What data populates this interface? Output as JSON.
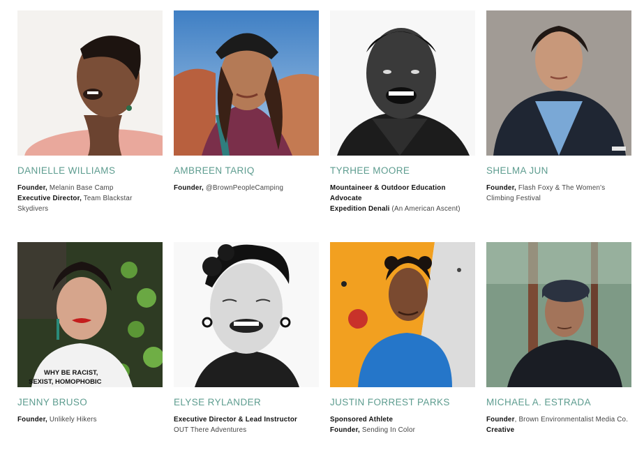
{
  "people": [
    {
      "name": "DANIELLE WILLIAMS",
      "photo_alt": "portrait-danielle",
      "roles": [
        {
          "title": "Founder,",
          "org": " Melanin Base Camp"
        },
        {
          "title": "Executive Director,",
          "org": " Team Blackstar Skydivers"
        }
      ]
    },
    {
      "name": "AMBREEN TARIQ",
      "photo_alt": "portrait-ambreen",
      "roles": [
        {
          "title": "Founder,",
          "org": " @BrownPeopleCamping"
        }
      ]
    },
    {
      "name": "TYRHEE MOORE",
      "photo_alt": "portrait-tyrhee",
      "roles": [
        {
          "title": "Mountaineer & Outdoor Education Advocate",
          "org": ""
        },
        {
          "title": "Expedition Denali",
          "org": " (An American Ascent)"
        }
      ]
    },
    {
      "name": "SHELMA JUN",
      "photo_alt": "portrait-shelma",
      "roles": [
        {
          "title": "Founder,",
          "org": " Flash Foxy & The Women's Climbing Festival"
        }
      ]
    },
    {
      "name": "JENNY BRUSO",
      "photo_alt": "portrait-jenny",
      "roles": [
        {
          "title": "Founder,",
          "org": " Unlikely Hikers"
        }
      ]
    },
    {
      "name": "ELYSE RYLANDER",
      "photo_alt": "portrait-elyse",
      "roles": [
        {
          "title": "Executive Director & Lead Instructor",
          "org": ""
        },
        {
          "title": "",
          "org": "OUT There Adventures"
        }
      ]
    },
    {
      "name": "JUSTIN FORREST PARKS",
      "photo_alt": "portrait-justin",
      "roles": [
        {
          "title": "Sponsored Athlete",
          "org": ""
        },
        {
          "title": "Founder,",
          "org": " Sending In Color"
        }
      ]
    },
    {
      "name": "MICHAEL A. ESTRADA",
      "photo_alt": "portrait-michael",
      "roles": [
        {
          "title": "Founder",
          "org": ", Brown Environmentalist Media Co."
        },
        {
          "title": "Creative",
          "org": ""
        }
      ]
    }
  ],
  "shirt_text": "WHY BE RACIST, SEXIST, HOMOPHOBIC",
  "colors": {
    "name_accent": "#5d9c8f"
  }
}
